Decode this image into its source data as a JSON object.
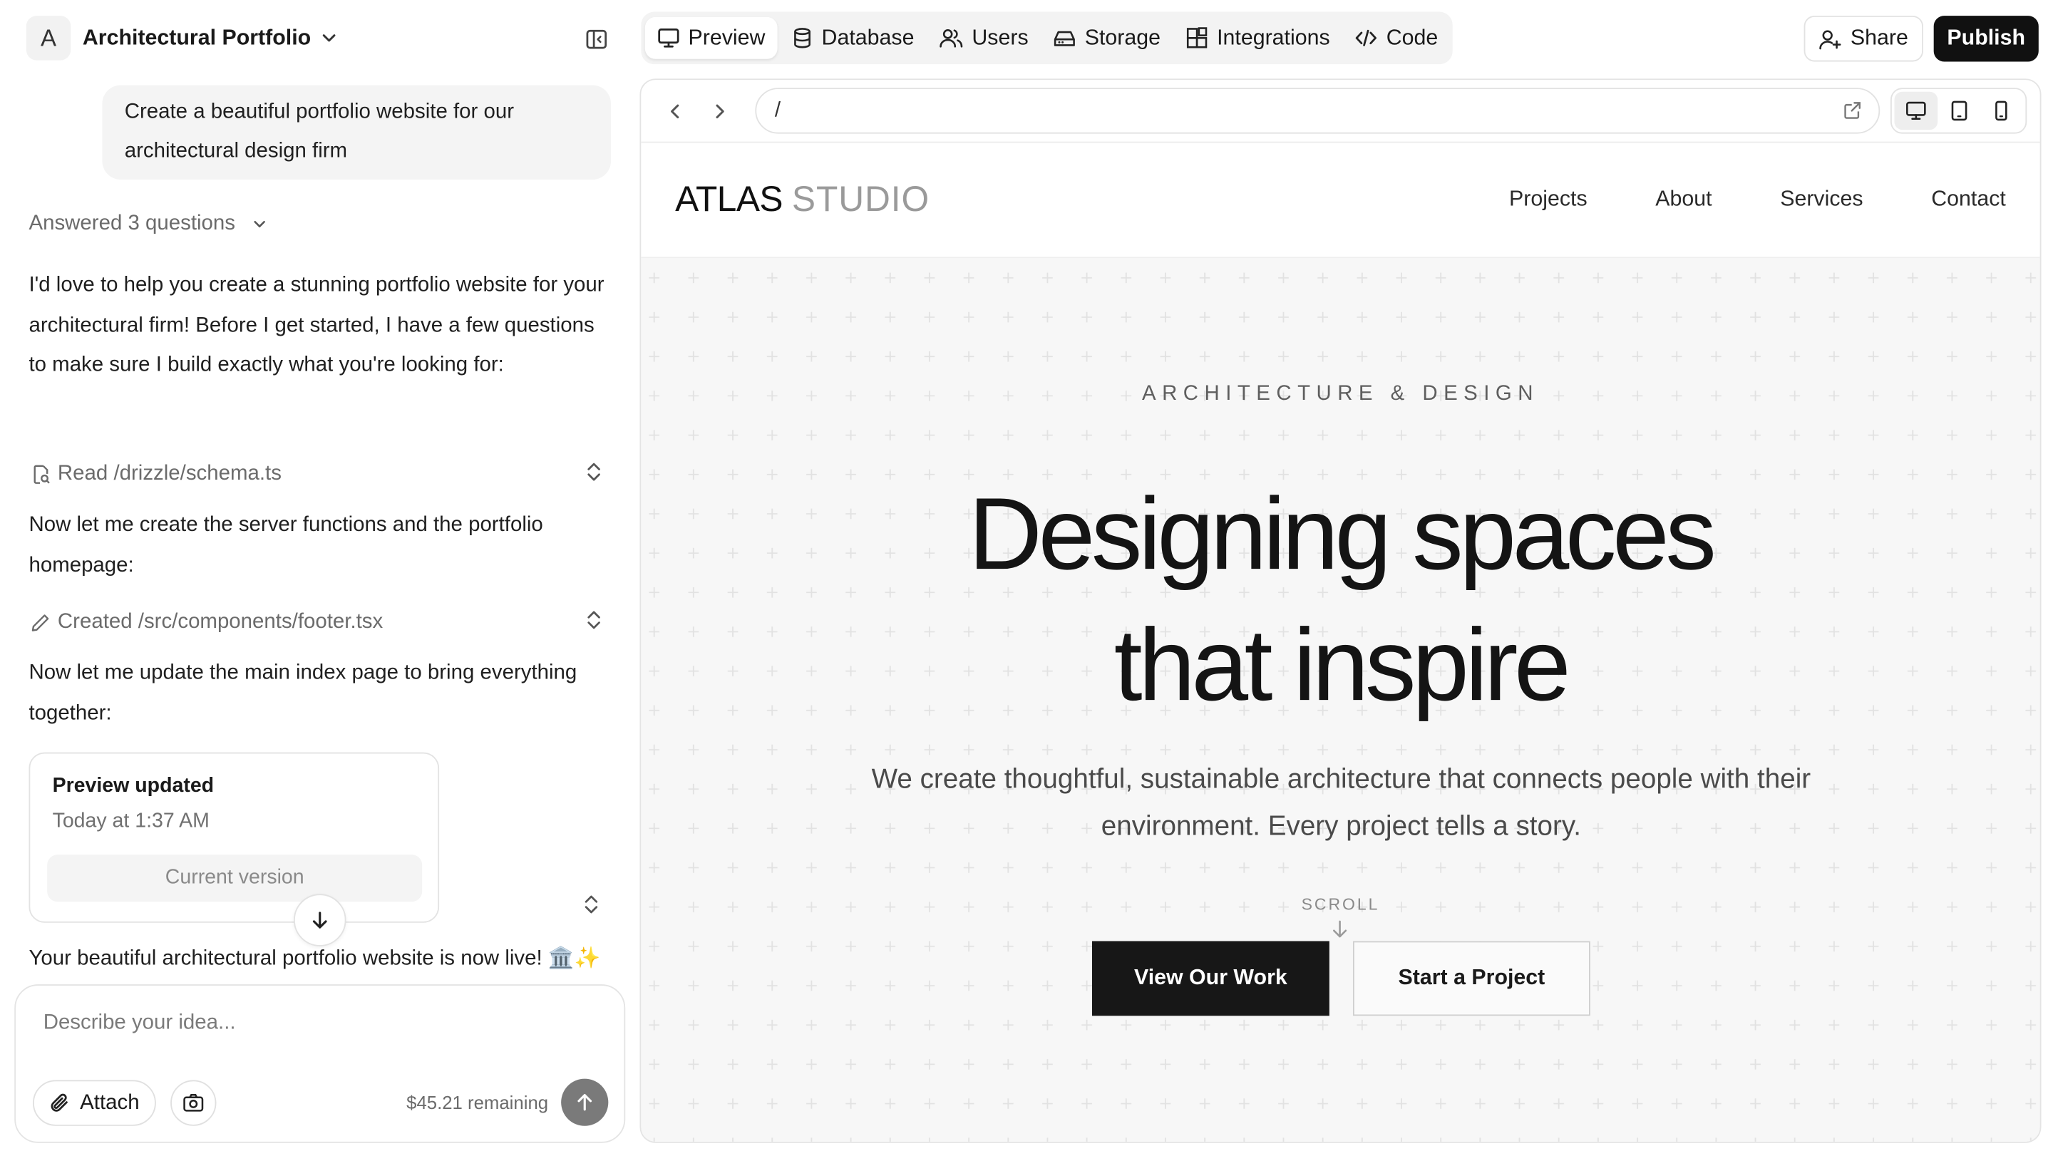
{
  "project": {
    "avatar_letter": "A",
    "name": "Architectural Portfolio"
  },
  "chat": {
    "user_message": "Create a beautiful portfolio website for our architectural design firm",
    "answered_label": "Answered 3 questions",
    "assistant_intro": "I'd love to help you create a stunning portfolio website for your architectural firm! Before I get started, I have a few questions to make sure I build exactly what you're looking for:",
    "tool_read": "Read /drizzle/schema.ts",
    "msg_server": "Now let me create the server functions and the portfolio homepage:",
    "tool_created": "Created /src/components/footer.tsx",
    "msg_update": "Now let me update the main index page to bring everything together:",
    "preview_card": {
      "title": "Preview updated",
      "time": "Today at 1:37 AM",
      "version": "Current version"
    },
    "live_message": "Your beautiful architectural portfolio website is now live! 🏛️✨"
  },
  "composer": {
    "placeholder": "Describe your idea...",
    "attach_label": "Attach",
    "remaining": "$45.21 remaining"
  },
  "tabs": [
    {
      "label": "Preview",
      "icon": "monitor-icon",
      "active": true
    },
    {
      "label": "Database",
      "icon": "database-icon"
    },
    {
      "label": "Users",
      "icon": "users-icon"
    },
    {
      "label": "Storage",
      "icon": "storage-icon"
    },
    {
      "label": "Integrations",
      "icon": "integrations-icon"
    },
    {
      "label": "Code",
      "icon": "code-icon"
    }
  ],
  "actions": {
    "share": "Share",
    "publish": "Publish"
  },
  "browser": {
    "url": "/",
    "active_device": "desktop"
  },
  "site": {
    "logo_primary": "ATLAS",
    "logo_secondary": "STUDIO",
    "nav": [
      "Projects",
      "About",
      "Services",
      "Contact"
    ],
    "eyebrow": "ARCHITECTURE & DESIGN",
    "headline_line1": "Designing spaces",
    "headline_line2": "that inspire",
    "subtitle": "We create thoughtful, sustainable architecture that connects people with their environment. Every project tells a story.",
    "scroll_label": "SCROLL",
    "cta_primary": "View Our Work",
    "cta_secondary": "Start a Project"
  },
  "colors": {
    "publish_bg": "#111111",
    "hero_bg": "#f7f7f7",
    "cta_primary_bg": "#171717",
    "send_bg": "#7a7a7a"
  }
}
